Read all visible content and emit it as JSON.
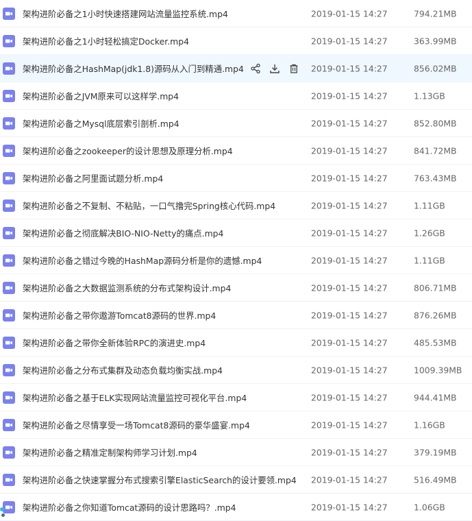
{
  "files": [
    {
      "name": "架构进阶必备之1小时快速搭建网站流量监控系统.mp4",
      "date": "2019-01-15 14:27",
      "size": "794.21MB"
    },
    {
      "name": "架构进阶必备之1小时轻松搞定Docker.mp4",
      "date": "2019-01-15 14:27",
      "size": "363.99MB"
    },
    {
      "name": "架构进阶必备之HashMap(jdk1.8)源码从入门到精通.mp4",
      "date": "2019-01-15 14:27",
      "size": "856.02MB"
    },
    {
      "name": "架构进阶必备之JVM原来可以这样学.mp4",
      "date": "2019-01-15 14:27",
      "size": "1.13GB"
    },
    {
      "name": "架构进阶必备之Mysql底层索引剖析.mp4",
      "date": "2019-01-15 14:27",
      "size": "852.80MB"
    },
    {
      "name": "架构进阶必备之zookeeper的设计思想及原理分析.mp4",
      "date": "2019-01-15 14:27",
      "size": "841.72MB"
    },
    {
      "name": "架构进阶必备之阿里面试题分析.mp4",
      "date": "2019-01-15 14:27",
      "size": "763.43MB"
    },
    {
      "name": "架构进阶必备之不复制、不粘贴，一口气撸完Spring核心代码.mp4",
      "date": "2019-01-15 14:27",
      "size": "1.11GB"
    },
    {
      "name": "架构进阶必备之彻底解决BIO-NIO-Netty的痛点.mp4",
      "date": "2019-01-15 14:27",
      "size": "1.26GB"
    },
    {
      "name": "架构进阶必备之错过今晚的HashMap源码分析是你的遗憾.mp4",
      "date": "2019-01-15 14:27",
      "size": "1.11GB"
    },
    {
      "name": "架构进阶必备之大数据监测系统的分布式架构设计.mp4",
      "date": "2019-01-15 14:27",
      "size": "806.71MB"
    },
    {
      "name": "架构进阶必备之带你遨游Tomcat8源码的世界.mp4",
      "date": "2019-01-15 14:27",
      "size": "876.26MB"
    },
    {
      "name": "架构进阶必备之带你全新体验RPC的演进史.mp4",
      "date": "2019-01-15 14:27",
      "size": "485.53MB"
    },
    {
      "name": "架构进阶必备之分布式集群及动态负载均衡实战.mp4",
      "date": "2019-01-15 14:27",
      "size": "1009.39MB"
    },
    {
      "name": "架构进阶必备之基于ELK实现网站流量监控可视化平台.mp4",
      "date": "2019-01-15 14:27",
      "size": "944.41MB"
    },
    {
      "name": "架构进阶必备之尽情享受一场Tomcat8源码的豪华盛宴.mp4",
      "date": "2019-01-15 14:27",
      "size": "1.16GB"
    },
    {
      "name": "架构进阶必备之精准定制架构师学习计划.mp4",
      "date": "2019-01-15 14:27",
      "size": "379.19MB"
    },
    {
      "name": "架构进阶必备之快速掌握分布式搜索引擎ElasticSearch的设计要领.mp4",
      "date": "2019-01-15 14:27",
      "size": "516.49MB"
    },
    {
      "name": "架构进阶必备之你知道Tomcat源码的设计思路吗？.mp4",
      "date": "2019-01-15 14:27",
      "size": "1.06GB"
    }
  ],
  "icons": {
    "file_type": "video-file-icon",
    "actions": [
      "share-icon",
      "download-icon",
      "delete-icon"
    ]
  },
  "colors": {
    "icon_bg": "#7c82e6",
    "highlight_row": "#f0f8ff",
    "action_icon": "#444444"
  }
}
